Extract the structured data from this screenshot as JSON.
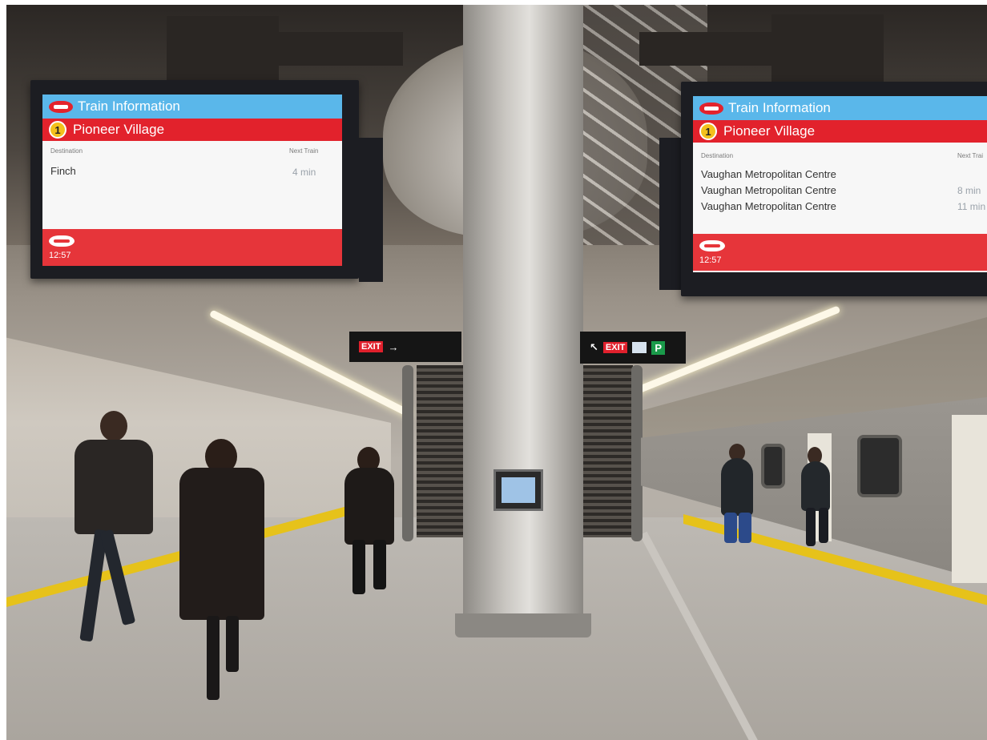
{
  "screens": {
    "left": {
      "title": "Train Information",
      "line_number": "1",
      "line_name": "Pioneer Village",
      "col_destination": "Destination",
      "col_next_train": "Next Train",
      "rows": [
        {
          "destination": "Finch",
          "time": "4 min"
        }
      ],
      "clock": "12:57"
    },
    "right": {
      "title": "Train Information",
      "line_number": "1",
      "line_name": "Pioneer Village",
      "col_destination": "Destination",
      "col_next_train": "Next Trai",
      "rows": [
        {
          "destination": "Vaughan Metropolitan Centre",
          "time": ""
        },
        {
          "destination": "Vaughan Metropolitan Centre",
          "time": "8 min"
        },
        {
          "destination": "Vaughan Metropolitan Centre",
          "time": "11 min"
        }
      ],
      "clock": "12:57"
    }
  },
  "signs": {
    "exit_left": "EXIT",
    "exit_left_arrow": "→",
    "exit_right_arrow": "↖",
    "exit_right": "EXIT",
    "parking": "P"
  },
  "icons": {
    "logo": "ttc-logo-icon",
    "line_badge": "line-1-badge-icon"
  },
  "colors": {
    "title_bar": "#5ab7ea",
    "line_bar": "#e2222c",
    "footer_bar": "#e6353a",
    "line_badge": "#f3c01c",
    "platform_edge": "#e6c21a"
  }
}
